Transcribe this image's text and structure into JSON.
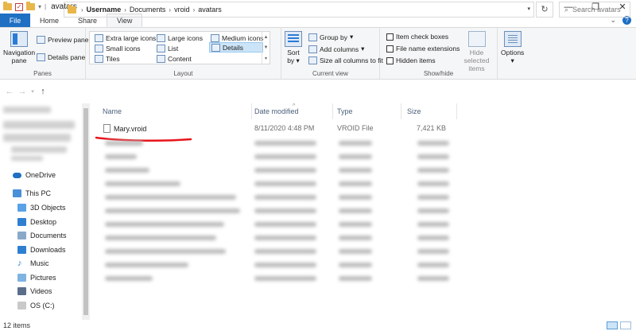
{
  "window": {
    "title": "avatars",
    "controls": [
      "—",
      "❐",
      "✕"
    ]
  },
  "tabs": {
    "file": "File",
    "home": "Home",
    "share": "Share",
    "view": "View"
  },
  "ribbon": {
    "panes": {
      "label": "Panes",
      "navigation_pane": "Navigation",
      "navigation_pane_2": "pane",
      "preview_pane": "Preview pane",
      "details_pane": "Details pane"
    },
    "layout": {
      "label": "Layout",
      "items": [
        "Extra large icons",
        "Large icons",
        "Medium icons",
        "Small icons",
        "List",
        "Details",
        "Tiles",
        "Content"
      ],
      "selected": "Details"
    },
    "current_view": {
      "label": "Current view",
      "sort_by": "Sort",
      "sort_by_2": "by",
      "group_by": "Group by",
      "add_columns": "Add columns",
      "size_columns": "Size all columns to fit"
    },
    "show_hide": {
      "label": "Show/hide",
      "item_check_boxes": "Item check boxes",
      "file_name_extensions": "File name extensions",
      "hidden_items": "Hidden items",
      "hide_selected": "Hide selected",
      "hide_selected_2": "items"
    },
    "options": "Options"
  },
  "address": {
    "crumbs": [
      "Username",
      "Documents",
      "vroid",
      "avatars"
    ],
    "search_placeholder": "Search avatars"
  },
  "nav": {
    "onedrive": "OneDrive",
    "this_pc": "This PC",
    "items": [
      "3D Objects",
      "Desktop",
      "Documents",
      "Downloads",
      "Music",
      "Pictures",
      "Videos",
      "OS (C:)"
    ]
  },
  "columns": {
    "name": "Name",
    "date": "Date modified",
    "type": "Type",
    "size": "Size"
  },
  "files": [
    {
      "name": "Mary.vroid",
      "date": "8/11/2020 4:48 PM",
      "type": "VROID File",
      "size": "7,421 KB"
    }
  ],
  "status": {
    "count": "12 items"
  },
  "colors": {
    "accent": "#1f6fc3",
    "annotation": "#e8141c"
  }
}
